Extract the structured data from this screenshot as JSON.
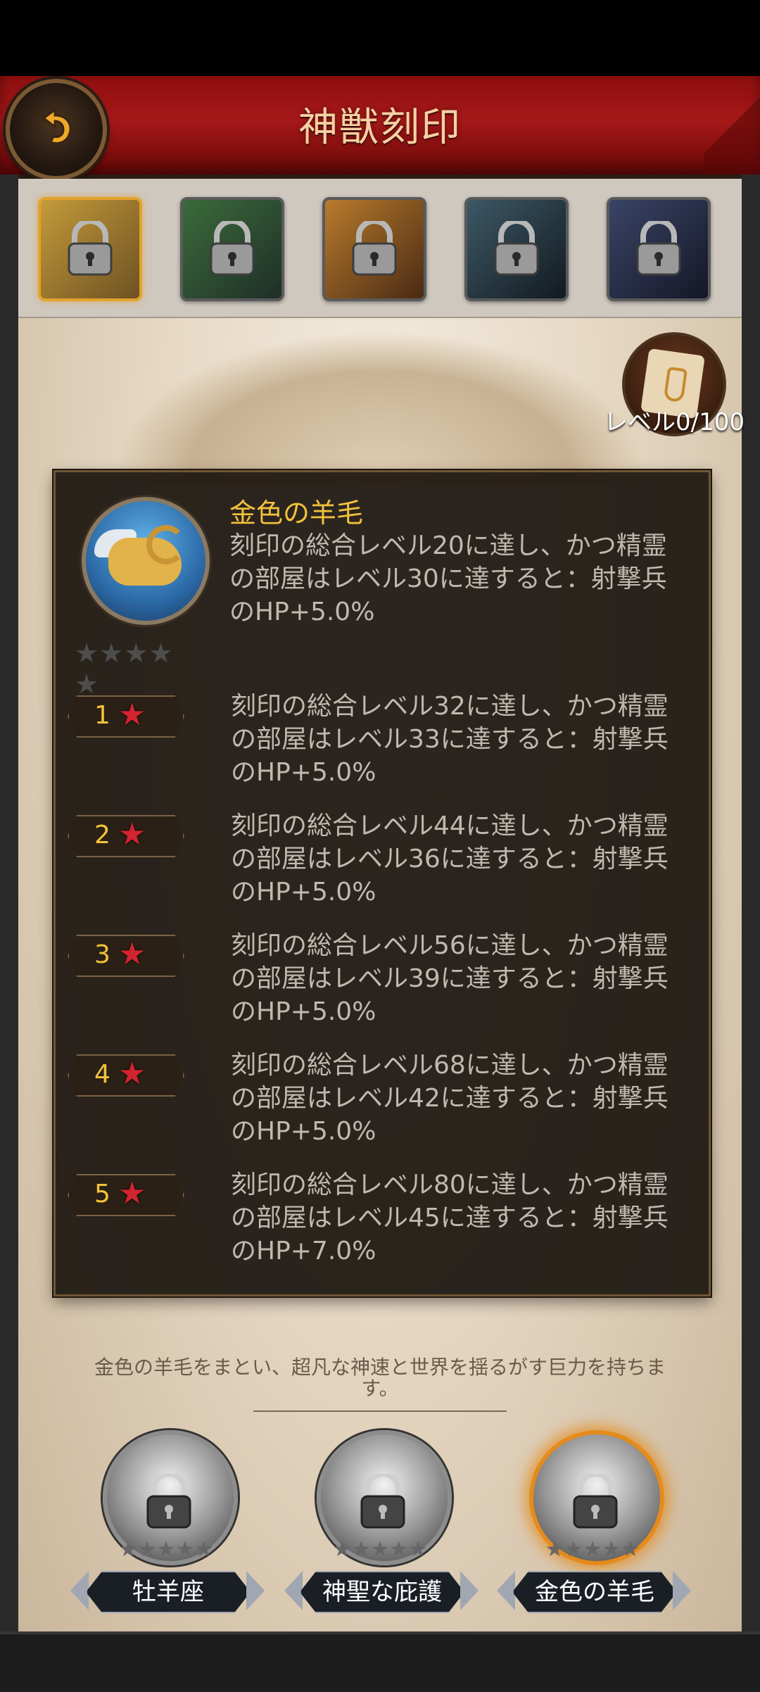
{
  "header": {
    "title": "神獣刻印"
  },
  "tabs": [
    {
      "name": "ram",
      "active": true
    },
    {
      "name": "forest-beast",
      "active": false
    },
    {
      "name": "lion",
      "active": false
    },
    {
      "name": "dragon",
      "active": false
    },
    {
      "name": "wolf",
      "active": false
    }
  ],
  "badge": {
    "label": "レベル0/100"
  },
  "card": {
    "title": "金色の羊毛",
    "description": "刻印の総合レベル20に達し、かつ精霊の部屋はレベル30に達すると：射撃兵のHP+5.0%",
    "stars_filled": 0,
    "stars_total": 5
  },
  "tiers": [
    {
      "num": "1",
      "text": "刻印の総合レベル32に達し、かつ精霊の部屋はレベル33に達すると：射撃兵のHP+5.0%"
    },
    {
      "num": "2",
      "text": "刻印の総合レベル44に達し、かつ精霊の部屋はレベル36に達すると：射撃兵のHP+5.0%"
    },
    {
      "num": "3",
      "text": "刻印の総合レベル56に達し、かつ精霊の部屋はレベル39に達すると：射撃兵のHP+5.0%"
    },
    {
      "num": "4",
      "text": "刻印の総合レベル68に達し、かつ精霊の部屋はレベル42に達すると：射撃兵のHP+5.0%"
    },
    {
      "num": "5",
      "text": "刻印の総合レベル80に達し、かつ精霊の部屋はレベル45に達すると：射撃兵のHP+7.0%"
    }
  ],
  "lore": "金色の羊毛をまとい、超凡な神速と世界を揺るがす巨力を持ちます。",
  "bottom_items": [
    {
      "label": "牡羊座",
      "locked": true
    },
    {
      "label": "神聖な庇護",
      "locked": true
    },
    {
      "label": "金色の羊毛",
      "locked": true,
      "selected": true
    }
  ]
}
